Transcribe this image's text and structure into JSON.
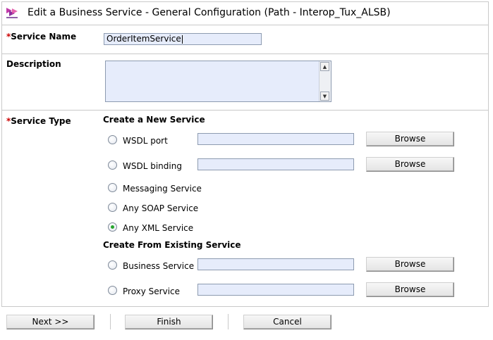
{
  "header": {
    "title": "Edit a Business Service - General Configuration (Path - Interop_Tux_ALSB)",
    "icon": "service-icon"
  },
  "service_name": {
    "required_mark": "*",
    "label": "Service Name",
    "value": "OrderItemService"
  },
  "description": {
    "label": "Description",
    "value": ""
  },
  "service_type": {
    "required_mark": "*",
    "label": "Service Type",
    "create_new_heading": "Create a New Service",
    "create_existing_heading": "Create From Existing Service",
    "options": {
      "wsdl_port": "WSDL port",
      "wsdl_binding": "WSDL binding",
      "messaging": "Messaging Service",
      "any_soap": "Any SOAP Service",
      "any_xml": "Any XML Service",
      "business": "Business Service",
      "proxy": "Proxy Service"
    },
    "selected": "Any XML Service",
    "browse_label": "Browse"
  },
  "footer": {
    "next_label": "Next >>",
    "finish_label": "Finish",
    "cancel_label": "Cancel"
  },
  "colors": {
    "required": "#cc0000",
    "input_bg": "#e6ecfb",
    "selected_radio": "#27a52e",
    "border": "#c9c9c9"
  }
}
